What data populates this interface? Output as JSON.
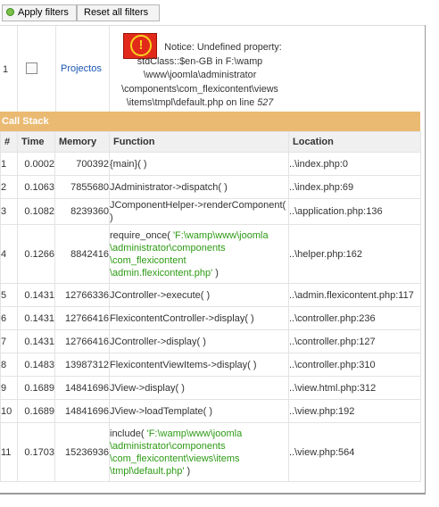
{
  "toolbar": {
    "apply_label": "Apply filters",
    "reset_label": "Reset all filters"
  },
  "item": {
    "number": "1",
    "title": "Projectos"
  },
  "notice": {
    "icon_text": "!",
    "line1": "Notice: Undefined property:",
    "line2": "stdClass::$en-GB in F:\\wamp",
    "line3": "\\www\\joomla\\administrator",
    "line4": "\\components\\com_flexicontent\\views",
    "line5_prefix": "\\items\\tmpl\\default.php on line ",
    "line5_number": "527"
  },
  "call_stack": {
    "title": "Call Stack",
    "headers": [
      "#",
      "Time",
      "Memory",
      "Function",
      "Location"
    ],
    "rows": [
      {
        "n": "1",
        "time": "0.0002",
        "memory": "700392",
        "function": "{main}( )",
        "path": "",
        "location": "..\\index.php:0"
      },
      {
        "n": "2",
        "time": "0.1063",
        "memory": "7855680",
        "function": "JAdministrator->dispatch( )",
        "path": "",
        "location": "..\\index.php:69"
      },
      {
        "n": "3",
        "time": "0.1082",
        "memory": "8239360",
        "function": "JComponentHelper->renderComponent( )",
        "path": "",
        "location": "..\\application.php:136"
      },
      {
        "n": "4",
        "time": "0.1266",
        "memory": "8842416",
        "function": "require_once(",
        "path": "'F:\\wamp\\www\\joomla \\administrator\\components \\com_flexicontent \\admin.flexicontent.php'",
        "suffix": " )",
        "location": "..\\helper.php:162"
      },
      {
        "n": "5",
        "time": "0.1431",
        "memory": "12766336",
        "function": "JController->execute( )",
        "path": "",
        "location": "..\\admin.flexicontent.php:117"
      },
      {
        "n": "6",
        "time": "0.1431",
        "memory": "12766416",
        "function": "FlexicontentController->display( )",
        "path": "",
        "location": "..\\controller.php:236"
      },
      {
        "n": "7",
        "time": "0.1431",
        "memory": "12766416",
        "function": "JController->display( )",
        "path": "",
        "location": "..\\controller.php:127"
      },
      {
        "n": "8",
        "time": "0.1483",
        "memory": "13987312",
        "function": "FlexicontentViewItems->display( )",
        "path": "",
        "location": "..\\controller.php:310"
      },
      {
        "n": "9",
        "time": "0.1689",
        "memory": "14841696",
        "function": "JView->display( )",
        "path": "",
        "location": "..\\view.html.php:312"
      },
      {
        "n": "10",
        "time": "0.1689",
        "memory": "14841696",
        "function": "JView->loadTemplate( )",
        "path": "",
        "location": "..\\view.php:192"
      },
      {
        "n": "11",
        "time": "0.1703",
        "memory": "15236936",
        "function": "include(",
        "path": "'F:\\wamp\\www\\joomla \\administrator\\components \\com_flexicontent\\views\\items \\tmpl\\default.php'",
        "suffix": " )",
        "location": "..\\view.php:564"
      }
    ]
  },
  "colors": {
    "header_bar": "#eaba72",
    "link": "#1b57b1",
    "path_green": "#2d9a14",
    "notice_icon": "#e12a1a"
  }
}
